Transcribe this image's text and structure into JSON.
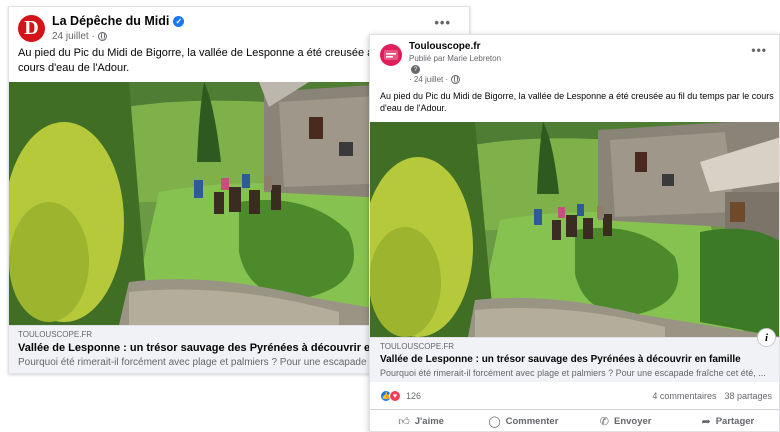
{
  "post1": {
    "page_name": "La Dépêche du Midi",
    "avatar_letter": "D",
    "date": "24 juillet ·",
    "text_lines": [
      "Au pied du Pic du Midi de Bigorre, la vallée de Lesponne a été creusée au fil du",
      "cours d'eau de l'Adour."
    ],
    "link": {
      "domain": "TOULOUSCOPE.FR",
      "title": "Vallée de Lesponne : un trésor sauvage des Pyrénées à découvrir en famille",
      "description": "Pourquoi été rimerait-il forcément avec plage et palmiers ? Pour une escapade fraîche cet été, ..."
    }
  },
  "post2": {
    "page_name": "Toulouscope.fr",
    "published_by": "Publié par Marie Lebreton",
    "date": "· 24 juillet ·",
    "text": "Au pied du Pic du Midi de Bigorre, la vallée de Lesponne a été creusée au fil du temps par le cours d'eau de l'Adour.",
    "link": {
      "domain": "TOULOUSCOPE.FR",
      "title": "Vallée de Lesponne : un trésor sauvage des Pyrénées à découvrir en famille",
      "description": "Pourquoi été rimerait-il forcément avec plage et palmiers ? Pour une escapade fraîche cet été, ..."
    },
    "reactions_count": "126",
    "comments": "4 commentaires",
    "shares": "38 partages",
    "actions": {
      "like": "J'aime",
      "comment": "Commenter",
      "send": "Envoyer",
      "share": "Partager"
    }
  },
  "icons": {
    "globe": "globe-icon",
    "more": "more-options-icon",
    "info": "info-icon",
    "like": "thumbs-up-icon",
    "love": "heart-icon"
  },
  "colors": {
    "brand_depeche": "#d3141b",
    "brand_toulouscope": "#e01e5a",
    "facebook_blue": "#1877f2",
    "love_red": "#f33e58"
  }
}
